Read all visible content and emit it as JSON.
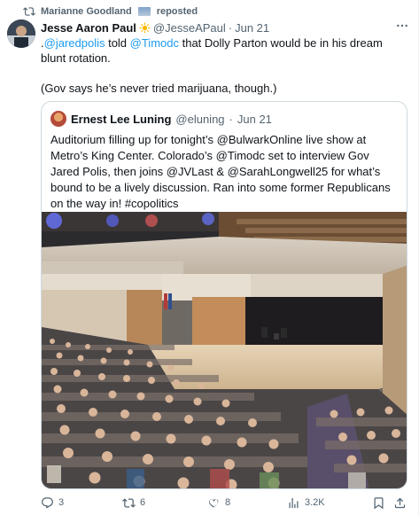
{
  "repost": {
    "label": "Marianne Goodland",
    "suffix": "reposted"
  },
  "tweet": {
    "author_name": "Jesse Aaron Paul",
    "handle": "@JesseAPaul",
    "separator": "·",
    "date": "Jun 21",
    "text_prefix": ".",
    "mention_1": "@jaredpolis",
    "text_middle": " told ",
    "mention_2": "@Timodc",
    "text_rest": " that Dolly Parton would be in his dream blunt rotation.",
    "text_para2": "(Gov says he’s never tried marijuana, though.)"
  },
  "quoted": {
    "author_name": "Ernest Lee Luning",
    "handle": "@eluning",
    "separator": "·",
    "date": "Jun 21",
    "text": "Auditorium filling up for tonight’s @BulwarkOnline live show at Metro’s King Center. Colorado’s @Timodc set to interview Gov Jared Polis, then joins @JVLast & @SarahLongwell25 for what’s bound to be a lively discussion. Ran into some former Republicans on the way in! #copolitics"
  },
  "actions": {
    "replies": "3",
    "reposts": "6",
    "likes": "8",
    "views": "3.2K"
  },
  "icons": {
    "repost": "repost-icon",
    "reply": "reply-icon",
    "like": "heart-icon",
    "views": "views-icon",
    "bookmark": "bookmark-icon",
    "share": "share-icon",
    "more": "more-icon"
  },
  "colors": {
    "link": "#1d9bf0",
    "muted": "#536471",
    "text": "#0f1419"
  }
}
